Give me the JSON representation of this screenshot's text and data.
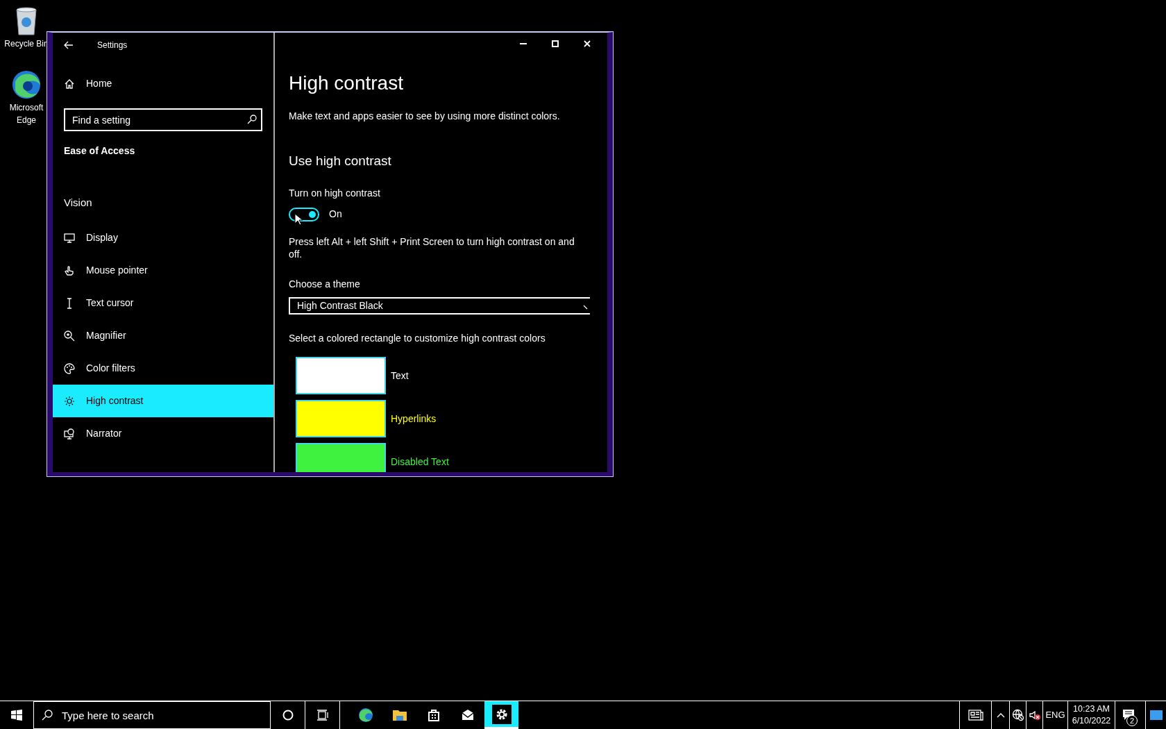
{
  "desktop_icons": [
    {
      "label": "Recycle Bin"
    },
    {
      "label": "Microsoft Edge"
    }
  ],
  "window": {
    "title": "Settings"
  },
  "sidebar": {
    "home": "Home",
    "search": {
      "placeholder": "Find a setting"
    },
    "section": "Ease of Access",
    "group": "Vision",
    "items": [
      {
        "label": "Display",
        "selected": false
      },
      {
        "label": "Mouse pointer",
        "selected": false
      },
      {
        "label": "Text cursor",
        "selected": false
      },
      {
        "label": "Magnifier",
        "selected": false
      },
      {
        "label": "Color filters",
        "selected": false
      },
      {
        "label": "High contrast",
        "selected": true
      },
      {
        "label": "Narrator",
        "selected": false
      }
    ]
  },
  "content": {
    "title": "High contrast",
    "description": "Make text and apps easier to see by using more distinct colors.",
    "section": "Use high contrast",
    "toggle_label": "Turn on high contrast",
    "toggle": {
      "on": true,
      "state_text": "On"
    },
    "shortcut": "Press left Alt + left Shift + Print Screen to turn high contrast on and off.",
    "theme_label": "Choose a theme",
    "theme_value": "High Contrast Black",
    "swatch_hint": "Select a colored rectangle to customize high contrast colors",
    "swatches": [
      {
        "label": "Text",
        "color": "#ffffff"
      },
      {
        "label": "Hyperlinks",
        "color": "#ffff00"
      },
      {
        "label": "Disabled Text",
        "color": "#3ff23f"
      }
    ]
  },
  "taskbar": {
    "search_placeholder": "Type here to search",
    "apps": [
      {
        "selected": false
      },
      {
        "selected": false
      },
      {
        "selected": false
      },
      {
        "selected": false
      },
      {
        "selected": true
      }
    ],
    "language": "ENG",
    "time": "10:23 AM",
    "date": "6/10/2022",
    "notification_count": "2"
  }
}
